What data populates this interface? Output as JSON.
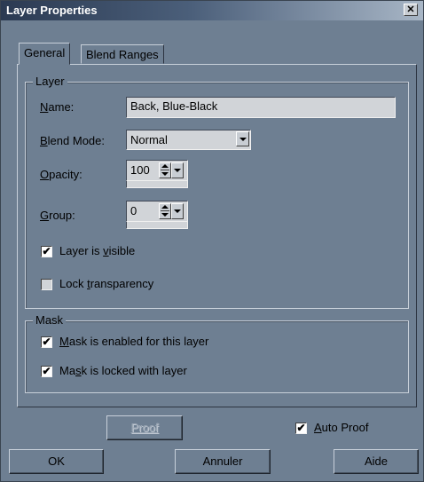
{
  "window": {
    "title": "Layer Properties",
    "close_label": "✕"
  },
  "tabs": [
    {
      "label": "General",
      "active": true
    },
    {
      "label": "Blend Ranges",
      "active": false
    }
  ],
  "layer_group": {
    "title": "Layer",
    "name_label": "Name:",
    "name_value": "Back, Blue-Black",
    "blend_mode_label": "Blend Mode:",
    "blend_mode_value": "Normal",
    "opacity_label": "Opacity:",
    "opacity_value": "100",
    "group_label": "Group:",
    "group_value": "0",
    "visible_label": "Layer is visible",
    "visible_checked": true,
    "lock_label": "Lock transparency",
    "lock_checked": false
  },
  "mask_group": {
    "title": "Mask",
    "enabled_label": "Mask is enabled for this layer",
    "enabled_checked": true,
    "locked_label": "Mask is locked with layer",
    "locked_checked": true
  },
  "footer": {
    "proof_label": "Proof",
    "auto_proof_label": "Auto Proof",
    "auto_proof_checked": true,
    "ok_label": "OK",
    "cancel_label": "Annuler",
    "help_label": "Aide"
  },
  "colors": {
    "dialog_bg": "#6e7f92",
    "title_bar": "#2b3a52",
    "field_bg": "#d1d4d8"
  },
  "check_mark": "✔"
}
